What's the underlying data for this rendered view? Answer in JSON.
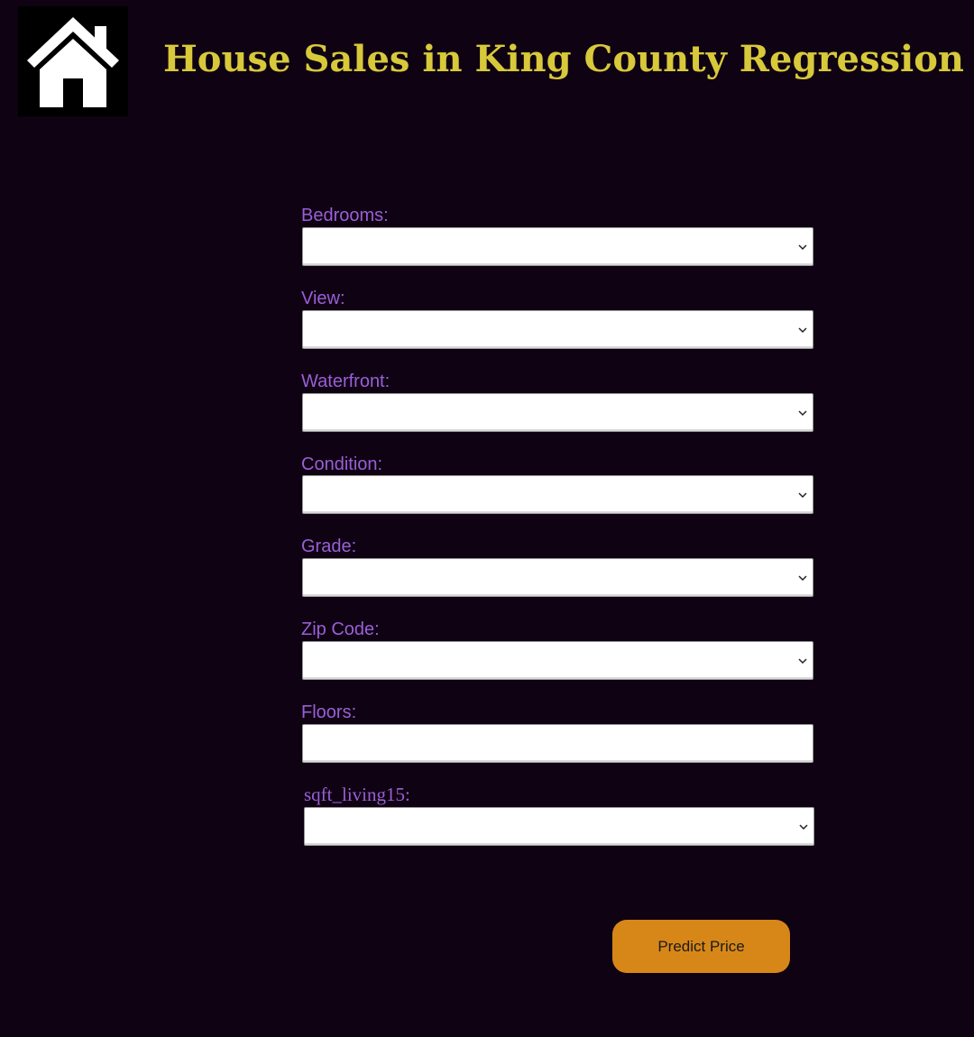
{
  "header": {
    "title": "House Sales in King County Regression",
    "logo_icon": "house-icon"
  },
  "form": {
    "fields": [
      {
        "label": "Bedrooms:",
        "type": "select",
        "value": ""
      },
      {
        "label": "View:",
        "type": "select",
        "value": ""
      },
      {
        "label": "Waterfront:",
        "type": "select",
        "value": ""
      },
      {
        "label": "Condition:",
        "type": "select",
        "value": ""
      },
      {
        "label": "Grade:",
        "type": "select",
        "value": ""
      },
      {
        "label": "Zip Code:",
        "type": "select",
        "value": ""
      },
      {
        "label": "Floors:",
        "type": "input",
        "value": ""
      },
      {
        "label": "sqft_living15:",
        "type": "select",
        "value": ""
      }
    ],
    "submit_label": "Predict Price"
  },
  "colors": {
    "background": "#0f0213",
    "title": "#d7c93a",
    "label": "#9a5fd6",
    "button": "#d78718"
  }
}
